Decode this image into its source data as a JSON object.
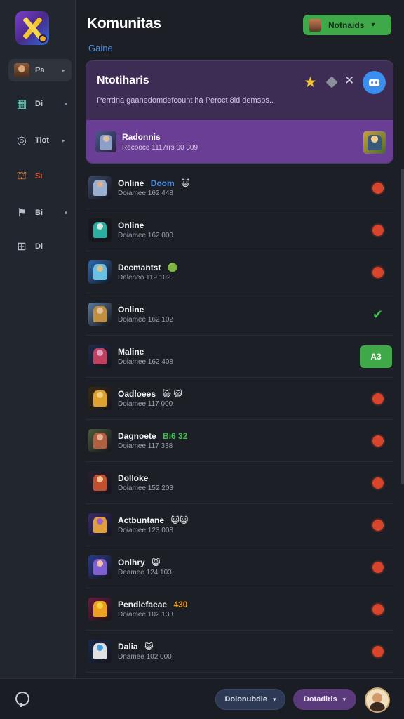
{
  "app": {
    "title": "Komunitas",
    "games_link": "Gaine"
  },
  "header": {
    "notif_button": {
      "label": "Notnaids"
    }
  },
  "sidebar": {
    "items": [
      {
        "label": "Pa",
        "icon": "user-avatar-icon"
      },
      {
        "label": "Di",
        "icon": "grid-icon"
      },
      {
        "label": "Tiot",
        "icon": "target-icon"
      },
      {
        "label": "Si",
        "icon": "shop-icon"
      },
      {
        "label": "Bi",
        "icon": "flag-icon"
      },
      {
        "label": "Di",
        "icon": "controller-icon"
      }
    ]
  },
  "notification": {
    "title": "Ntotiharis",
    "subtitle": "Perrdna gaanedomdefcount ha Peroct 8id demsbs..",
    "featured": {
      "name": "Radonnis",
      "meta": "Recoocd   1117rrs   00 309"
    }
  },
  "games": [
    {
      "name": "Online",
      "badge": "Doom",
      "badge_color": "#4a8fe0",
      "emoji": "😺",
      "meta": "Doiamee   162 448",
      "status": "dot"
    },
    {
      "name": "Online",
      "badge": "",
      "badge_color": "",
      "emoji": "",
      "meta": "Doiamee   162 000",
      "status": "dot"
    },
    {
      "name": "Decmantst",
      "badge": "",
      "badge_color": "",
      "emoji": "🟢",
      "meta": "Daleneo   119 102",
      "status": "dot"
    },
    {
      "name": "Online",
      "badge": "",
      "badge_color": "",
      "emoji": "",
      "meta": "Doiamee   162 102",
      "status": "check"
    },
    {
      "name": "Maline",
      "badge": "",
      "badge_color": "",
      "emoji": "",
      "meta": "Doiamee   162 408",
      "status": "play",
      "play_label": "A3"
    },
    {
      "name": "Oadloees",
      "badge": "",
      "badge_color": "",
      "emoji": "😺 😺",
      "meta": "Doiamee   117 000",
      "status": "dot"
    },
    {
      "name": "Dagnoete",
      "badge": "Bi6 32",
      "badge_color": "#3cc24a",
      "emoji": "",
      "meta": "Doiamee   117 338",
      "status": "dot"
    },
    {
      "name": "Dolloke",
      "badge": "",
      "badge_color": "",
      "emoji": "",
      "meta": "Doiamee   152 203",
      "status": "dot"
    },
    {
      "name": "Actbuntane",
      "badge": "",
      "badge_color": "",
      "emoji": "😺😺",
      "meta": "Doiamee   123 008",
      "status": "dot"
    },
    {
      "name": "Onlhry",
      "badge": "",
      "badge_color": "",
      "emoji": "😺",
      "meta": "Deamee   124 103",
      "status": "dot"
    },
    {
      "name": "Pendlefaeae",
      "badge": "430",
      "badge_color": "#f0a020",
      "emoji": "",
      "meta": "Doiamee   102 133",
      "status": "dot"
    },
    {
      "name": "Dalia",
      "badge": "",
      "badge_color": "",
      "emoji": "😺",
      "meta": "Dnamee   102 000",
      "status": "dot"
    }
  ],
  "bottom": {
    "filter1": "Dolonubdie",
    "filter2": "Dotadiris"
  },
  "colors": {
    "accent_green": "#3fa848",
    "accent_blue": "#3a8ef0",
    "panel_purple": "#3d2c54",
    "status_red": "#d8452a"
  }
}
